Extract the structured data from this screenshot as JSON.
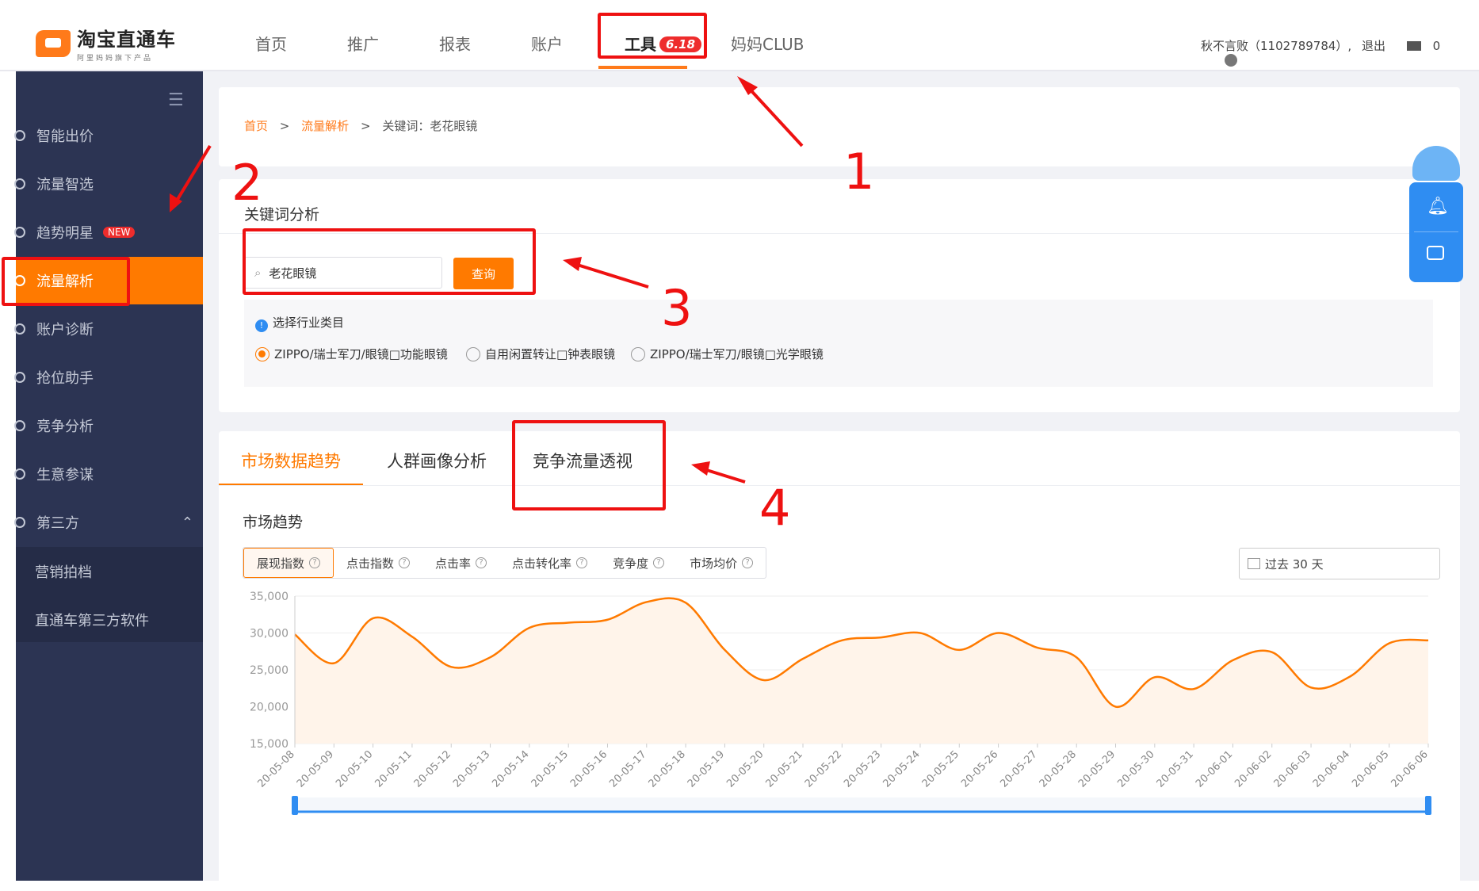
{
  "header": {
    "logo_title": "淘宝直通车",
    "logo_sub": "阿里妈妈旗下产品",
    "nav": [
      "首页",
      "推广",
      "报表",
      "账户",
      "工具",
      "妈妈CLUB"
    ],
    "active_badge": "6.18",
    "user_text": "秋不言败（1102789784）,",
    "logout": "退出",
    "mail_count": "0"
  },
  "sidebar": {
    "items": [
      "智能出价",
      "流量智选",
      "趋势明星",
      "流量解析",
      "账户诊断",
      "抢位助手",
      "竞争分析",
      "生意参谋",
      "第三方"
    ],
    "new_badge": "NEW",
    "sub_items": [
      "营销拍档",
      "直通车第三方软件"
    ]
  },
  "breadcrumb": {
    "home": "首页",
    "parent": "流量解析",
    "current": "关键词：老花眼镜"
  },
  "keyword_panel": {
    "title": "关键词分析",
    "search_value": "老花眼镜",
    "query_btn": "查询",
    "industry_label": "选择行业类目",
    "options": [
      "ZIPPO/瑞士军刀/眼镜□功能眼镜",
      "自用闲置转让□钟表眼镜",
      "ZIPPO/瑞士军刀/眼镜□光学眼镜"
    ]
  },
  "tabs": [
    "市场数据趋势",
    "人群画像分析",
    "竞争流量透视"
  ],
  "trend": {
    "title": "市场趋势",
    "metrics": [
      "展现指数",
      "点击指数",
      "点击率",
      "点击转化率",
      "竞争度",
      "市场均价"
    ],
    "date_range": "过去 30 天"
  },
  "annotations": [
    "1",
    "2",
    "3",
    "4"
  ],
  "chart_data": {
    "type": "area",
    "x": [
      "20-05-08",
      "20-05-09",
      "20-05-10",
      "20-05-11",
      "20-05-12",
      "20-05-13",
      "20-05-14",
      "20-05-15",
      "20-05-16",
      "20-05-17",
      "20-05-18",
      "20-05-19",
      "20-05-20",
      "20-05-21",
      "20-05-22",
      "20-05-23",
      "20-05-24",
      "20-05-25",
      "20-05-26",
      "20-05-27",
      "20-05-28",
      "20-05-29",
      "20-05-30",
      "20-05-31",
      "20-06-01",
      "20-06-02",
      "20-06-03",
      "20-06-04",
      "20-06-05",
      "20-06-06"
    ],
    "values": [
      29800,
      25900,
      32000,
      29500,
      25400,
      26700,
      30700,
      31400,
      31800,
      34200,
      34100,
      27700,
      23600,
      26500,
      29000,
      29400,
      30000,
      27700,
      30000,
      28000,
      26700,
      20000,
      24000,
      22400,
      26300,
      27400,
      22600,
      24100,
      28600,
      29000
    ],
    "yticks": [
      "35,000",
      "30,000",
      "25,000",
      "20,000",
      "15,000"
    ],
    "ylim": [
      15000,
      35000
    ],
    "color": "#ff7a00",
    "fill": "#fff4ea"
  }
}
